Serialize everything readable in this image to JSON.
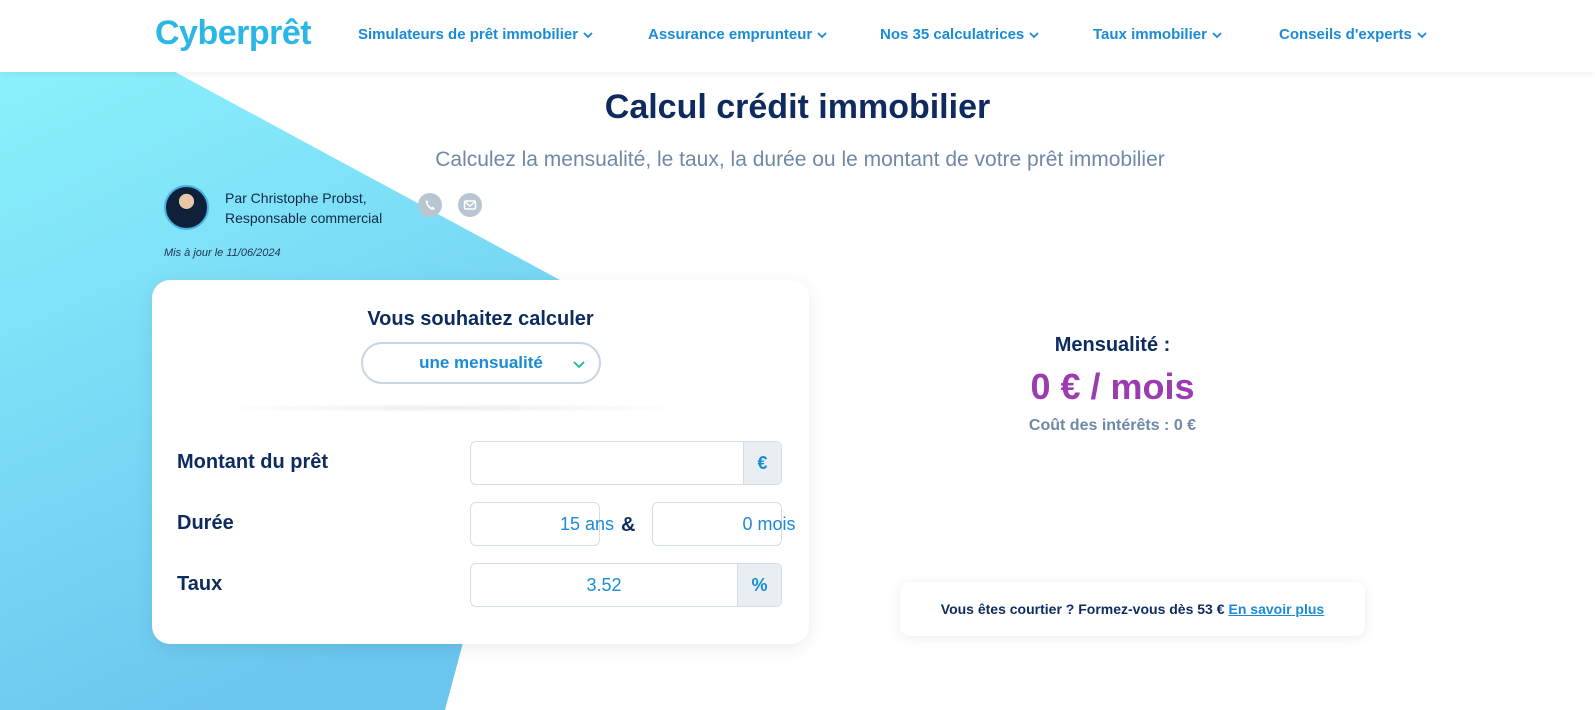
{
  "header": {
    "logo": "Cyberprêt",
    "nav": [
      {
        "label": "Simulateurs de prêt immobilier"
      },
      {
        "label": "Assurance emprunteur"
      },
      {
        "label": "Nos 35 calculatrices"
      },
      {
        "label": "Taux immobilier"
      },
      {
        "label": "Conseils d'experts"
      }
    ]
  },
  "page": {
    "title": "Calcul crédit immobilier",
    "subtitle": "Calculez la mensualité, le taux, la durée ou le montant de votre prêt immobilier"
  },
  "author": {
    "line1": "Par Christophe Probst,",
    "line2": "Responsable commercial",
    "updated": "Mis à jour le 11/06/2024"
  },
  "calculator": {
    "title": "Vous souhaitez calculer",
    "mode": "une mensualité",
    "amount_label": "Montant du prêt",
    "amount_value": "",
    "amount_unit": "€",
    "duration_label": "Durée",
    "duration_years": "15 ans",
    "duration_sep": "&",
    "duration_months": "0 mois",
    "rate_label": "Taux",
    "rate_value": "3.52",
    "rate_unit": "%"
  },
  "result": {
    "label": "Mensualité :",
    "value": "0 € / mois",
    "cost": "Coût des intérêts : 0 €"
  },
  "promo": {
    "text": "Vous êtes courtier ? Formez-vous dès 53 €",
    "link": "En savoir plus"
  },
  "colors": {
    "accent": "#1b8bd6",
    "navy": "#0d2b5e",
    "purple": "#9b3db0",
    "cyan": "#7ee8fa"
  }
}
